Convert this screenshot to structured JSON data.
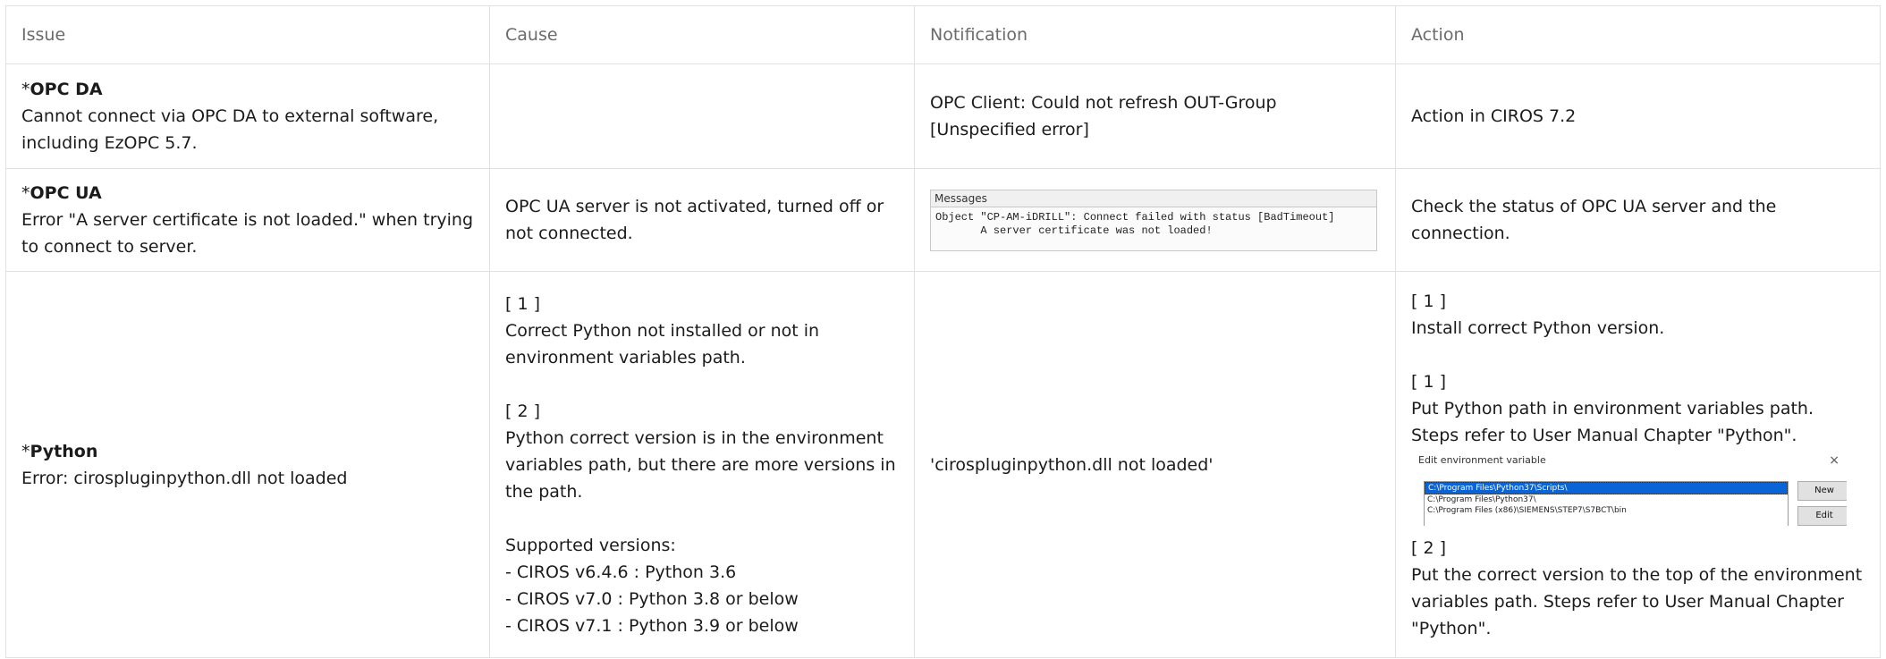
{
  "headers": [
    "Issue",
    "Cause",
    "Notification",
    "Action"
  ],
  "rows": [
    {
      "issue_prefix": "*",
      "issue_title": "OPC DA",
      "issue_desc": "Cannot connect via OPC DA to external software, including EzOPC 5.7.",
      "cause": "",
      "notification": "OPC Client: Could not refresh OUT-Group [Unspecified error]",
      "action": "Action in CIROS 7.2"
    },
    {
      "issue_prefix": "*",
      "issue_title": "OPC UA",
      "issue_desc": "Error \"A server certificate is not loaded.\" when trying to connect to server.",
      "cause": "OPC UA server is not activated, turned off or not connected.",
      "notification_image": {
        "header": "Messages",
        "line1": "Object \"CP-AM-iDRILL\": Connect failed with status [BadTimeout]",
        "line2": "       A server certificate was not loaded!"
      },
      "action": "Check the status of OPC UA server and the connection."
    },
    {
      "issue_prefix": "*",
      "issue_title": "Python",
      "issue_desc": "Error: cirospluginpython.dll not loaded",
      "cause": {
        "label1": "[ 1 ]",
        "text1": "Correct Python not installed or not in environment variables path.",
        "label2": "[ 2 ]",
        "text2": "Python correct version is in the environment variables path, but there are more versions in the path.",
        "supported_title": "Supported versions:",
        "supported": [
          "- CIROS v6.4.6 : Python 3.6",
          "- CIROS v7.0 : Python 3.8 or below",
          "- CIROS v7.1 : Python 3.9 or below"
        ]
      },
      "notification": "'cirospluginpython.dll not loaded'",
      "action": {
        "label1": "[ 1 ]",
        "text1": "Install correct Python version.",
        "label2": "[ 1 ]",
        "text2a": "Put Python path in environment variables path.",
        "text2b": "Steps refer to User Manual Chapter \"Python\".",
        "env_image": {
          "title": "Edit environment variable",
          "close": "×",
          "entries": [
            "C:\\Program Files\\Python37\\Scripts\\",
            "C:\\Program Files\\Python37\\",
            "C:\\Program Files (x86)\\SIEMENS\\STEP7\\S7BCT\\bin"
          ],
          "button_new": "New",
          "button_edit": "Edit"
        },
        "label3": "[ 2 ]",
        "text3": "Put the correct version to the top of the environment variables path. Steps refer to User Manual Chapter \"Python\"."
      }
    }
  ]
}
